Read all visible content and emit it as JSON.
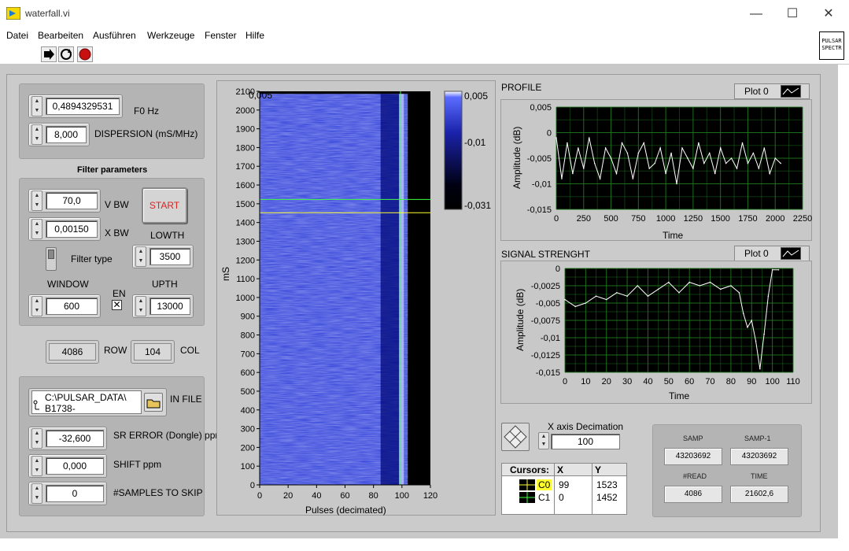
{
  "window": {
    "title": "waterfall.vi",
    "minimize": "—",
    "maximize": "☐",
    "close": "✕"
  },
  "menu": [
    "Datei",
    "Bearbeiten",
    "Ausführen",
    "Werkzeuge",
    "Fenster",
    "Hilfe"
  ],
  "vi_icon": {
    "line1": "PULSAR",
    "line2": "SPECTR"
  },
  "controls": {
    "f0": {
      "value": "0,4894329531",
      "label": "F0 Hz"
    },
    "dispersion": {
      "value": "8,000",
      "label": "DISPERSION (mS/MHz)"
    },
    "filter_title": "Filter parameters",
    "vbw": {
      "value": "70,0",
      "label": "V BW"
    },
    "xbw": {
      "value": "0,00150",
      "label": "X BW"
    },
    "start_label": "START",
    "lowth": {
      "value": "3500",
      "label": "LOWTH"
    },
    "filter_type_label": "Filter type",
    "window": {
      "value": "600",
      "label": "WINDOW"
    },
    "en_label": "EN",
    "en_checked": true,
    "upth": {
      "value": "13000",
      "label": "UPTH"
    },
    "row": {
      "value": "4086",
      "label": "ROW"
    },
    "col": {
      "value": "104",
      "label": "COL"
    },
    "in_file": {
      "line1": "C:\\PULSAR_DATA\\",
      "line2": "B1738-",
      "label": "IN FILE"
    },
    "sr_error": {
      "value": "-32,600",
      "label": "SR ERROR (Dongle) ppm"
    },
    "shift": {
      "value": "0,000",
      "label": "SHIFT ppm"
    },
    "samples_skip": {
      "value": "0",
      "label": "#SAMPLES TO SKIP"
    },
    "x_decimation": {
      "value": "100",
      "label": "X axis Decimation"
    }
  },
  "stats": {
    "samp": {
      "label": "SAMP",
      "value": "43203692"
    },
    "samp1": {
      "label": "SAMP-1",
      "value": "43203692"
    },
    "nread": {
      "label": "#READ",
      "value": "4086"
    },
    "time": {
      "label": "TIME",
      "value": "21602,6"
    }
  },
  "cursors": {
    "header": [
      "Cursors:",
      "X",
      "Y"
    ],
    "rows": [
      {
        "name": "C0",
        "x": "99",
        "y": "1523"
      },
      {
        "name": "C1",
        "x": "0",
        "y": "1452"
      }
    ]
  },
  "colors": {
    "accent_start": "#e02020",
    "waterfall_blue": "#2a3ad8",
    "plot_bg": "#000000",
    "plot_grid": "#1f7a1f",
    "trace": "#ffffff",
    "cursor0": "#ffff30",
    "cursor1": "#40ff40"
  },
  "chart_data": [
    {
      "type": "heatmap",
      "title": "",
      "xlabel": "Pulses (decimated)",
      "ylabel": "mS",
      "xlim": [
        0,
        120
      ],
      "ylim": [
        0,
        2100
      ],
      "xticks": [
        "0",
        "20",
        "40",
        "60",
        "80",
        "100",
        "120"
      ],
      "yticks": [
        "0",
        "100",
        "200",
        "300",
        "400",
        "500",
        "600",
        "700",
        "800",
        "900",
        "1000",
        "1100",
        "1200",
        "1300",
        "1400",
        "1500",
        "1600",
        "1700",
        "1800",
        "1900",
        "2000",
        "2100"
      ],
      "data_extent": {
        "x": [
          0,
          104
        ],
        "y": [
          0,
          2086
        ]
      },
      "bright_band_x": [
        85,
        98
      ],
      "colorbar": {
        "labels": [
          "0,005",
          "-0,01",
          "-0,031"
        ],
        "range": [
          -0.031,
          0.005
        ]
      },
      "cursors": [
        {
          "name": "C0",
          "x": 99,
          "y": 1523
        },
        {
          "name": "C1",
          "x": 0,
          "y": 1452
        }
      ]
    },
    {
      "type": "line",
      "title": "PROFILE",
      "legend": "Plot 0",
      "xlabel": "Time",
      "ylabel": "Amplitude (dB)",
      "xlim": [
        0,
        2250
      ],
      "ylim": [
        -0.015,
        0.005
      ],
      "xticks": [
        "0",
        "250",
        "500",
        "750",
        "1000",
        "1250",
        "1500",
        "1750",
        "2000",
        "2250"
      ],
      "yticks": [
        "0,005",
        "0",
        "-0,005",
        "-0,01",
        "-0,015"
      ],
      "series": [
        {
          "x": [
            0,
            50,
            100,
            150,
            200,
            250,
            300,
            350,
            400,
            450,
            500,
            550,
            600,
            650,
            700,
            750,
            800,
            850,
            900,
            950,
            1000,
            1050,
            1100,
            1150,
            1200,
            1250,
            1300,
            1350,
            1400,
            1450,
            1500,
            1550,
            1600,
            1650,
            1700,
            1750,
            1800,
            1850,
            1900,
            1950,
            2000,
            2050
          ],
          "values": [
            -0.001,
            -0.009,
            -0.002,
            -0.008,
            -0.003,
            -0.007,
            -0.001,
            -0.006,
            -0.009,
            -0.003,
            -0.005,
            -0.008,
            -0.002,
            -0.004,
            -0.009,
            -0.004,
            -0.002,
            -0.007,
            -0.006,
            -0.003,
            -0.008,
            -0.004,
            -0.01,
            -0.003,
            -0.005,
            -0.007,
            -0.002,
            -0.006,
            -0.004,
            -0.008,
            -0.003,
            -0.006,
            -0.005,
            -0.007,
            -0.002,
            -0.006,
            -0.004,
            -0.007,
            -0.003,
            -0.008,
            -0.005,
            -0.006
          ]
        }
      ]
    },
    {
      "type": "line",
      "title": "SIGNAL STRENGHT",
      "legend": "Plot 0",
      "xlabel": "Time",
      "ylabel": "Amplitude (dB)",
      "xlim": [
        0,
        110
      ],
      "ylim": [
        -0.015,
        0
      ],
      "xticks": [
        "0",
        "10",
        "20",
        "30",
        "40",
        "50",
        "60",
        "70",
        "80",
        "90",
        "100",
        "110"
      ],
      "yticks": [
        "0",
        "-0,0025",
        "-0,005",
        "-0,0075",
        "-0,01",
        "-0,0125",
        "-0,015"
      ],
      "series": [
        {
          "x": [
            0,
            5,
            10,
            15,
            20,
            25,
            30,
            35,
            40,
            45,
            50,
            55,
            60,
            65,
            70,
            75,
            80,
            84,
            86,
            88,
            90,
            92,
            94,
            96,
            98,
            100,
            103
          ],
          "values": [
            -0.0045,
            -0.0055,
            -0.005,
            -0.004,
            -0.0045,
            -0.0035,
            -0.004,
            -0.0025,
            -0.004,
            -0.003,
            -0.002,
            -0.0035,
            -0.002,
            -0.0025,
            -0.002,
            -0.003,
            -0.0025,
            -0.0035,
            -0.0065,
            -0.0085,
            -0.0075,
            -0.0105,
            -0.0145,
            -0.0095,
            -0.004,
            -0.0002,
            -0.0002
          ]
        }
      ]
    }
  ]
}
